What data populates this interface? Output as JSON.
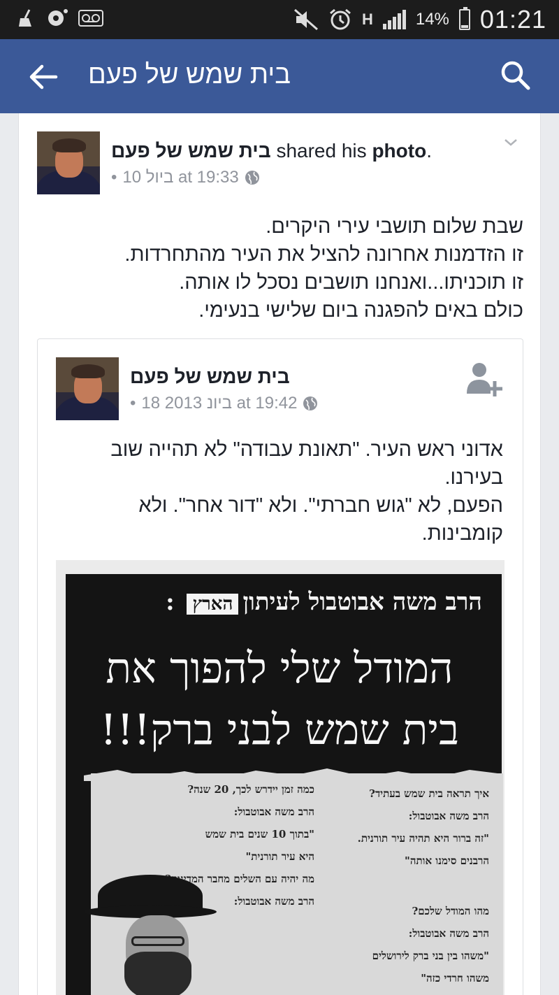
{
  "status_bar": {
    "battery": "14%",
    "time": "01:21",
    "network": "H",
    "battery_level": 0.14,
    "icons": [
      "broom-icon",
      "photo-icon",
      "voicemail-icon",
      "mute-icon",
      "alarm-icon",
      "signal-icon",
      "battery-icon"
    ]
  },
  "app_bar": {
    "title": "בית שמש של פעם",
    "back_icon": "arrow-left-icon",
    "search_icon": "search-icon",
    "color": "#3b5998"
  },
  "post": {
    "author": "בית שמש של פעם",
    "action_pre": " shared his ",
    "action_obj": "photo",
    "action_end": ".",
    "date": "10 ביול at 19:33",
    "menu_icon": "chevron-down-icon",
    "privacy_icon": "globe-icon",
    "body_lines": [
      "שבת שלום תושבי עירי היקרים.",
      "זו הזדמנות אחרונה להציל את העיר מהתחרדות.",
      "זו תוכניתו...ואנחנו תושבים נסכל לו אותה.",
      "כולם באים להפגנה ביום שלישי בנעימי."
    ]
  },
  "shared": {
    "author": "בית שמש של פעם",
    "date": "18 ביונ 2013 at 19:42",
    "add_friend_icon": "add-friend-icon",
    "body_lines": [
      "אדוני ראש העיר. \"תאונת עבודה\" לא תהייה שוב",
      "בעירנו.",
      "הפעם, לא \"גוש חברתי\". ולא \"דור אחר\". ולא",
      "קומבינות."
    ],
    "photo": {
      "line1": "הרב משה אבוטבול לעיתון",
      "tag": "הארץ",
      "line1_end": " :",
      "headline1": "המודל שלי להפוך את",
      "headline2": "בית שמש לבני ברק!!!",
      "col_left": [
        "כמה זמן יידרש לכך, 20 שנה?",
        "הרב משה אבוטבול:",
        "\"בתוך 10 שנים בית שמש",
        "היא עיר תורנית\"",
        "מה יהיה עם השלים מחבר המדינות?",
        "הרב משה אבוטבול:"
      ],
      "col_right": [
        "איך תראה בית שמש בעתיד?",
        "הרב משה אבוטבול:",
        "\"זה ברור היא תהיה עיר תורנית.",
        "הרבנים סימנו אותה\"",
        "מהו המודל שלכם?",
        "הרב משה אבוטבול:",
        "\"משהו בין בני ברק לירושלים",
        "משהו חרדי כזה\""
      ]
    }
  }
}
